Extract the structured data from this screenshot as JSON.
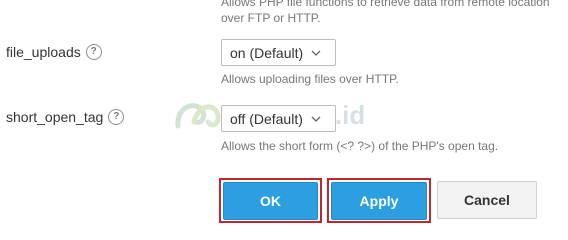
{
  "top_hint": "Allows PHP file functions to retrieve data from remote location over FTP or HTTP.",
  "settings": [
    {
      "label": "file_uploads",
      "help": "?",
      "value": "on (Default)",
      "hint": "Allows uploading files over HTTP."
    },
    {
      "label": "short_open_tag",
      "help": "?",
      "value": "off (Default)",
      "hint": "Allows the short form (<? ?>) of the PHP's open tag."
    }
  ],
  "watermark": "nginstall.id",
  "buttons": {
    "ok": "OK",
    "apply": "Apply",
    "cancel": "Cancel"
  },
  "colors": {
    "primary": "#2b9fe0",
    "highlight_border": "#c0262c",
    "default_button": "#f3f3f3"
  }
}
